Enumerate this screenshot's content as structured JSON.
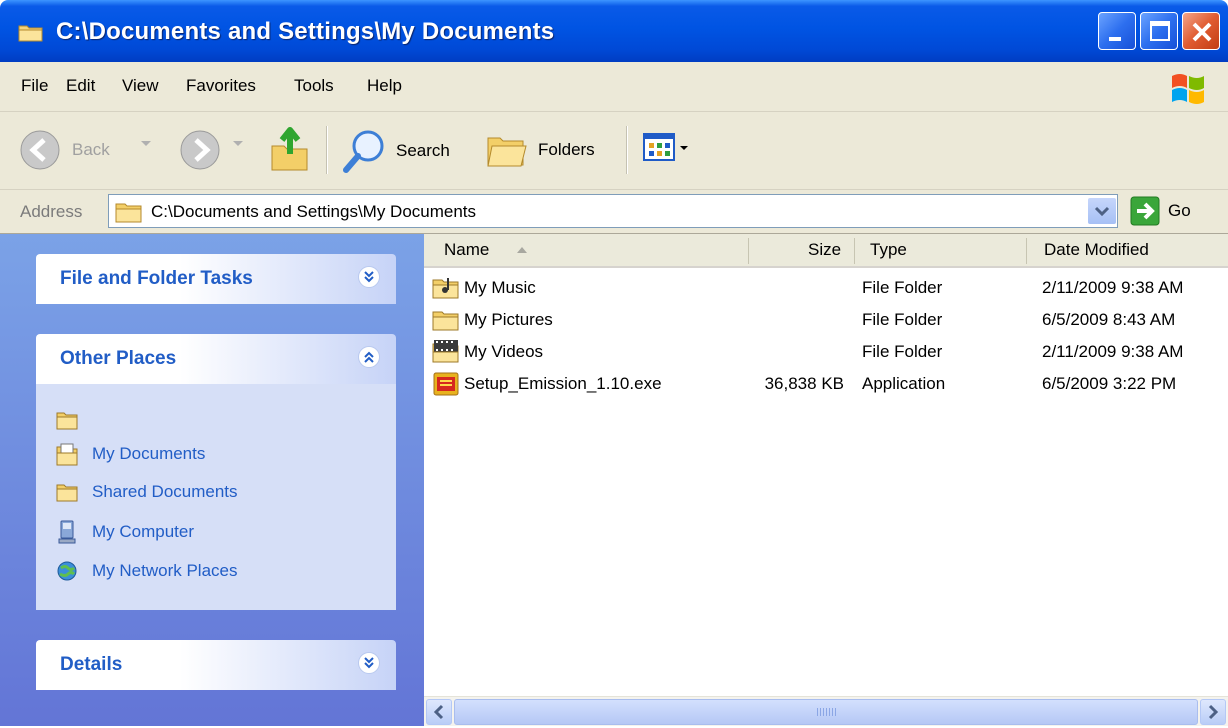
{
  "window": {
    "title": "C:\\Documents and Settings\\My Documents",
    "controls": [
      "minimize",
      "maximize",
      "close"
    ]
  },
  "menu": {
    "items": [
      "File",
      "Edit",
      "View",
      "Favorites",
      "Tools",
      "Help"
    ]
  },
  "toolbar": {
    "back_label": "Back",
    "search_label": "Search",
    "folders_label": "Folders",
    "icons": [
      "back-icon",
      "forward-icon",
      "up-folder-icon",
      "search-icon",
      "folders-icon",
      "views-icon"
    ]
  },
  "address": {
    "label": "Address",
    "value": "C:\\Documents and Settings\\My Documents",
    "go_label": "Go"
  },
  "task_pane": {
    "file_tasks": {
      "title": "File and Folder Tasks",
      "state": "collapsed"
    },
    "other_places": {
      "title": "Other Places",
      "state": "expanded",
      "items": [
        {
          "label": "",
          "icon": "folder-icon"
        },
        {
          "label": "My Documents",
          "icon": "my-documents-icon"
        },
        {
          "label": "Shared Documents",
          "icon": "folder-icon"
        },
        {
          "label": "My Computer",
          "icon": "computer-icon"
        },
        {
          "label": "My Network Places",
          "icon": "network-icon"
        }
      ]
    },
    "details": {
      "title": "Details",
      "state": "collapsed"
    }
  },
  "file_list": {
    "columns": {
      "name": "Name",
      "size": "Size",
      "type": "Type",
      "date": "Date Modified"
    },
    "sort_column": "Name",
    "rows": [
      {
        "name": "My Music",
        "size": "",
        "type": "File Folder",
        "date": "2/11/2009 9:38 AM",
        "icon": "music-folder-icon"
      },
      {
        "name": "My Pictures",
        "size": "",
        "type": "File Folder",
        "date": "6/5/2009 8:43 AM",
        "icon": "folder-icon"
      },
      {
        "name": "My Videos",
        "size": "",
        "type": "File Folder",
        "date": "2/11/2009 9:38 AM",
        "icon": "video-folder-icon"
      },
      {
        "name": "Setup_Emission_1.10.exe",
        "size": "36,838 KB",
        "type": "Application",
        "date": "6/5/2009 3:22 PM",
        "icon": "installer-icon"
      }
    ]
  },
  "colors": {
    "titlebar": "#0054e3",
    "task_pane": "#7ba2e7",
    "panel_title": "#215dc6",
    "chrome": "#ece9d8"
  }
}
